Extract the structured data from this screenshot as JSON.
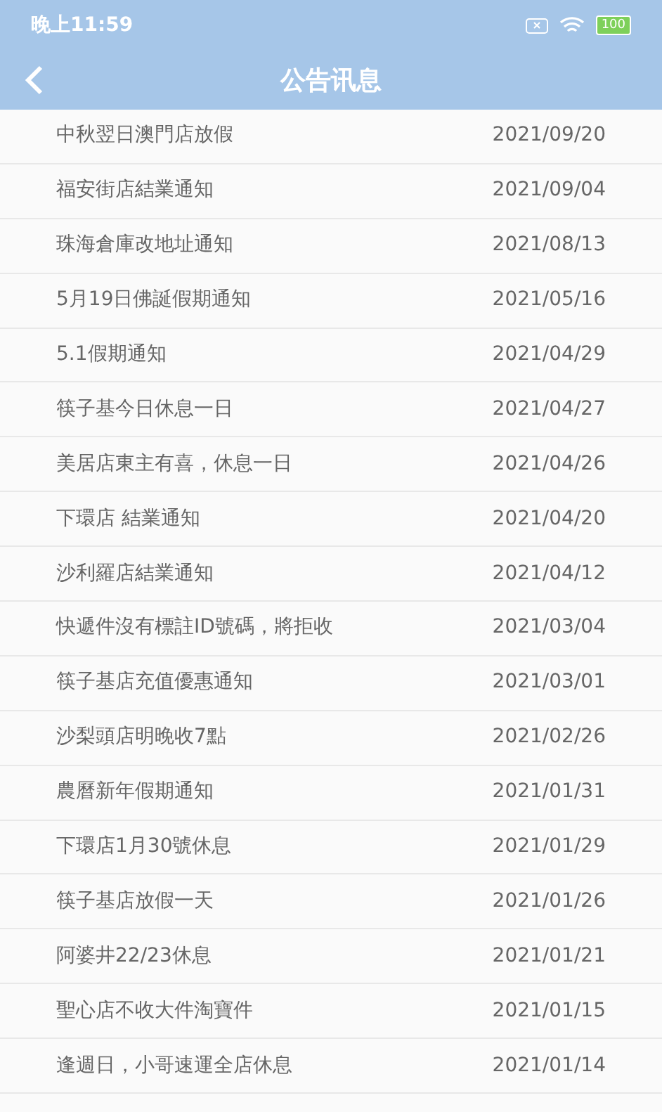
{
  "status_bar": {
    "time": "晚上11:59",
    "battery": "100"
  },
  "header": {
    "title": "公告讯息"
  },
  "notices": [
    {
      "title": "中秋翌日澳門店放假",
      "date": "2021/09/20"
    },
    {
      "title": "福安街店結業通知",
      "date": "2021/09/04"
    },
    {
      "title": "珠海倉庫改地址通知",
      "date": "2021/08/13"
    },
    {
      "title": "5月19日佛誕假期通知",
      "date": "2021/05/16"
    },
    {
      "title": "5.1假期通知",
      "date": "2021/04/29"
    },
    {
      "title": "筷子基今日休息一日",
      "date": "2021/04/27"
    },
    {
      "title": "美居店東主有喜，休息一日",
      "date": "2021/04/26"
    },
    {
      "title": "下環店 結業通知",
      "date": "2021/04/20"
    },
    {
      "title": "沙利羅店結業通知",
      "date": "2021/04/12"
    },
    {
      "title": "快遞件沒有標註ID號碼，將拒收",
      "date": "2021/03/04"
    },
    {
      "title": "筷子基店充值優惠通知",
      "date": "2021/03/01"
    },
    {
      "title": "沙梨頭店明晚收7點",
      "date": "2021/02/26"
    },
    {
      "title": "農曆新年假期通知",
      "date": "2021/01/31"
    },
    {
      "title": "下環店1月30號休息",
      "date": "2021/01/29"
    },
    {
      "title": "筷子基店放假一天",
      "date": "2021/01/26"
    },
    {
      "title": "阿婆井22/23休息",
      "date": "2021/01/21"
    },
    {
      "title": "聖心店不收大件淘寶件",
      "date": "2021/01/15"
    },
    {
      "title": "逢週日，小哥速運全店休息",
      "date": "2021/01/14"
    }
  ]
}
